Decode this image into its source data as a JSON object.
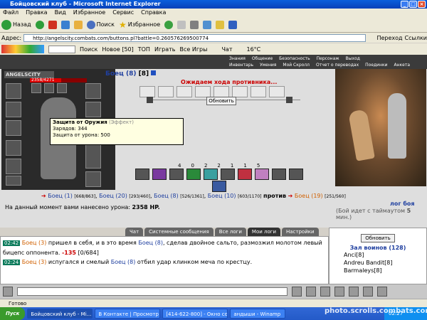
{
  "window": {
    "title": "Бойцовский клуб - Microsoft Internet Explorer"
  },
  "menu": [
    "Файл",
    "Правка",
    "Вид",
    "Избранное",
    "Сервис",
    "Справка"
  ],
  "toolbar": {
    "back": "Назад",
    "search": "Поиск",
    "favorites": "Избранное"
  },
  "address": {
    "label": "Адрес:",
    "url": "http://angelscity.combats.com/buttons.pl?battle=0.260576269500774",
    "go": "Переход",
    "links": "Ссылки"
  },
  "links_bar": {
    "search": "Поиск",
    "new": "Новое [50]",
    "top": "ТОП",
    "play": "Играть",
    "all_games": "Все Игры",
    "chat": "Чат",
    "temp": "16°C"
  },
  "game_nav": {
    "row1": [
      "Знания",
      "Общение",
      "Безопасность",
      "Персонаж",
      "Выход"
    ],
    "row2": [
      "Инвентарь",
      "Умения",
      "Мой Скролл",
      "Отчет о переводах",
      "Поединки",
      "Анкета"
    ]
  },
  "logo": "ANGELSCITY",
  "player": {
    "hp_text": "2358/4271",
    "hp_fraction": 0.55,
    "name": "Боец",
    "level": "(8)",
    "bracket": "[8]"
  },
  "battle": {
    "waiting": "Ожидаем хода противника...",
    "refresh": "Обновить"
  },
  "tooltip": {
    "title": "Защита от Оружия",
    "effect": "(Эффект)",
    "charges": "Зарядов: 344",
    "protection": "Защита от урона: 500"
  },
  "counters": [
    "4",
    "0",
    "2",
    "2",
    "1",
    "1",
    "5"
  ],
  "fighters": [
    {
      "name": "Боец (1)",
      "hp": "[668/863]"
    },
    {
      "name": "Боец (20)",
      "hp": "[293/460]"
    },
    {
      "name": "Боец (8)",
      "hp": "[526/1361]"
    },
    {
      "name": "Боец (10)",
      "hp": "[603/1170]"
    }
  ],
  "versus": "против",
  "opponent": {
    "name": "Боец (19)",
    "hp": "[251/560]"
  },
  "damage": {
    "text": "На данный момент вами нанесено урона:",
    "value": "2358 HP."
  },
  "battle_log": {
    "link": "лог боя",
    "timeout_pre": "(Бой идет с таймаутом ",
    "timeout_val": "5",
    "timeout_post": " мин.)"
  },
  "tabs": [
    "Чат",
    "Системные сообщения",
    "Все логи",
    "Мои логи",
    "Настройки"
  ],
  "chat": [
    {
      "time": "02:42",
      "actor": "Боец (3)",
      "text": "пришел в себя, и в это время",
      "target": "Боец (8)",
      "text2": ", сделав двойное сальто, размозжил молотом левый бицепс оппонента.",
      "dmg": "-135",
      "hp": "[0/684]"
    },
    {
      "time": "02:24",
      "actor": "Боец (3)",
      "text": "испугался и смелый",
      "target": "Боец (8)",
      "text2": "отбил удар клинком меча по крестцу."
    }
  ],
  "side": {
    "refresh": "Обновить",
    "title": "Зал воинов (128)",
    "users": [
      {
        "name": "Anci",
        "lvl": "[8]"
      },
      {
        "name": "Andreu Bandit",
        "lvl": "[8]"
      },
      {
        "name": "Barmaleys",
        "lvl": "[8]"
      }
    ]
  },
  "status": {
    "text": "Готово"
  },
  "taskbar": {
    "start": "Пуск",
    "tasks": [
      "Бойцовский клуб - Mi...",
      "В Контакте | Просмотр ...",
      "[414-622-800] - Окно со...",
      "андыши - Winamp"
    ],
    "watermark": "photo.scrolls.combats.com",
    "clock": "02:27"
  },
  "colors": {
    "accent": "#c00000",
    "link": "#2040a0"
  }
}
